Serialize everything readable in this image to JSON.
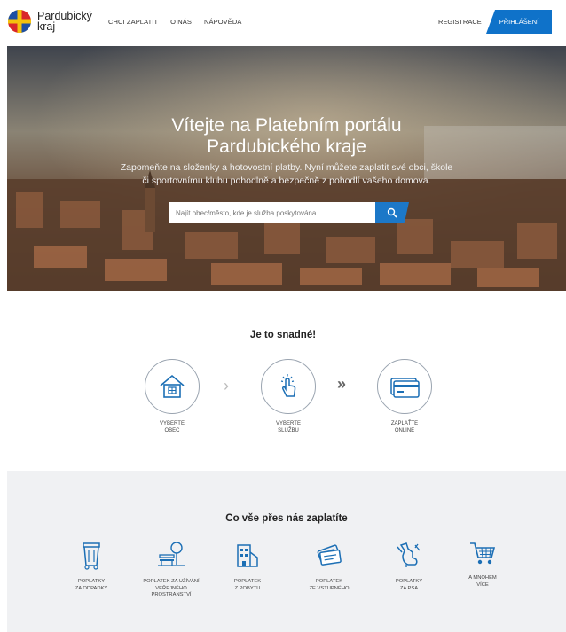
{
  "header": {
    "logo_line1": "Pardubický",
    "logo_line2": "kraj",
    "nav": [
      "CHCI ZAPLATIT",
      "O NÁS",
      "NÁPOVĚDA"
    ],
    "register": "REGISTRACE",
    "login": "PŘIHLÁŠENÍ"
  },
  "hero": {
    "title_line1": "Vítejte na Platebním portálu",
    "title_line2": "Pardubického kraje",
    "subtitle_line1": "Zapomeňte na složenky a hotovostní platby. Nyní můžete zaplatit své obci, škole",
    "subtitle_line2": "či sportovnímu klubu pohodlně a bezpečně z pohodlí vašeho domova.",
    "search_placeholder": "Najít obec/město, kde je služba poskytována..."
  },
  "steps": {
    "title": "Je to snadné!",
    "items": [
      {
        "line1": "VYBERTE",
        "line2": "OBEC",
        "icon": "house-icon"
      },
      {
        "line1": "VYBERTE",
        "line2": "SLUŽBU",
        "icon": "touch-icon"
      },
      {
        "line1": "ZAPLAŤTE",
        "line2": "ONLINE",
        "icon": "card-icon"
      }
    ]
  },
  "pay": {
    "title": "Co vše přes nás zaplatíte",
    "items": [
      {
        "label": "POPLATKY\nZA ODPADKY",
        "icon": "trash-bin-icon"
      },
      {
        "label": "POPLATEK ZA UŽÍVÁNÍ\nVEŘEJNÉHO\nPROSTRANSTVÍ",
        "icon": "park-bench-icon"
      },
      {
        "label": "POPLATEK\nZ POBYTU",
        "icon": "hotel-icon"
      },
      {
        "label": "POPLATEK\nZE VSTUPNÉHO",
        "icon": "tickets-icon"
      },
      {
        "label": "POPLATKY\nZA PSA",
        "icon": "dog-icon"
      },
      {
        "label": "A MNOHEM\nVÍCE",
        "icon": "shopping-cart-icon"
      }
    ]
  },
  "colors": {
    "brand": "#0f72c9",
    "icon": "#1c6fb5"
  }
}
